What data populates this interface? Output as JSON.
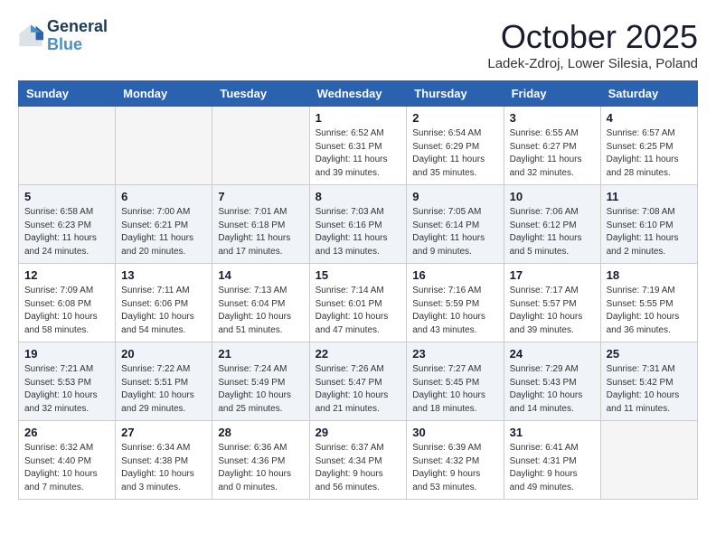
{
  "logo": {
    "line1": "General",
    "line2": "Blue"
  },
  "title": "October 2025",
  "subtitle": "Ladek-Zdroj, Lower Silesia, Poland",
  "weekdays": [
    "Sunday",
    "Monday",
    "Tuesday",
    "Wednesday",
    "Thursday",
    "Friday",
    "Saturday"
  ],
  "weeks": [
    [
      {
        "day": "",
        "info": ""
      },
      {
        "day": "",
        "info": ""
      },
      {
        "day": "",
        "info": ""
      },
      {
        "day": "1",
        "info": "Sunrise: 6:52 AM\nSunset: 6:31 PM\nDaylight: 11 hours\nand 39 minutes."
      },
      {
        "day": "2",
        "info": "Sunrise: 6:54 AM\nSunset: 6:29 PM\nDaylight: 11 hours\nand 35 minutes."
      },
      {
        "day": "3",
        "info": "Sunrise: 6:55 AM\nSunset: 6:27 PM\nDaylight: 11 hours\nand 32 minutes."
      },
      {
        "day": "4",
        "info": "Sunrise: 6:57 AM\nSunset: 6:25 PM\nDaylight: 11 hours\nand 28 minutes."
      }
    ],
    [
      {
        "day": "5",
        "info": "Sunrise: 6:58 AM\nSunset: 6:23 PM\nDaylight: 11 hours\nand 24 minutes."
      },
      {
        "day": "6",
        "info": "Sunrise: 7:00 AM\nSunset: 6:21 PM\nDaylight: 11 hours\nand 20 minutes."
      },
      {
        "day": "7",
        "info": "Sunrise: 7:01 AM\nSunset: 6:18 PM\nDaylight: 11 hours\nand 17 minutes."
      },
      {
        "day": "8",
        "info": "Sunrise: 7:03 AM\nSunset: 6:16 PM\nDaylight: 11 hours\nand 13 minutes."
      },
      {
        "day": "9",
        "info": "Sunrise: 7:05 AM\nSunset: 6:14 PM\nDaylight: 11 hours\nand 9 minutes."
      },
      {
        "day": "10",
        "info": "Sunrise: 7:06 AM\nSunset: 6:12 PM\nDaylight: 11 hours\nand 5 minutes."
      },
      {
        "day": "11",
        "info": "Sunrise: 7:08 AM\nSunset: 6:10 PM\nDaylight: 11 hours\nand 2 minutes."
      }
    ],
    [
      {
        "day": "12",
        "info": "Sunrise: 7:09 AM\nSunset: 6:08 PM\nDaylight: 10 hours\nand 58 minutes."
      },
      {
        "day": "13",
        "info": "Sunrise: 7:11 AM\nSunset: 6:06 PM\nDaylight: 10 hours\nand 54 minutes."
      },
      {
        "day": "14",
        "info": "Sunrise: 7:13 AM\nSunset: 6:04 PM\nDaylight: 10 hours\nand 51 minutes."
      },
      {
        "day": "15",
        "info": "Sunrise: 7:14 AM\nSunset: 6:01 PM\nDaylight: 10 hours\nand 47 minutes."
      },
      {
        "day": "16",
        "info": "Sunrise: 7:16 AM\nSunset: 5:59 PM\nDaylight: 10 hours\nand 43 minutes."
      },
      {
        "day": "17",
        "info": "Sunrise: 7:17 AM\nSunset: 5:57 PM\nDaylight: 10 hours\nand 39 minutes."
      },
      {
        "day": "18",
        "info": "Sunrise: 7:19 AM\nSunset: 5:55 PM\nDaylight: 10 hours\nand 36 minutes."
      }
    ],
    [
      {
        "day": "19",
        "info": "Sunrise: 7:21 AM\nSunset: 5:53 PM\nDaylight: 10 hours\nand 32 minutes."
      },
      {
        "day": "20",
        "info": "Sunrise: 7:22 AM\nSunset: 5:51 PM\nDaylight: 10 hours\nand 29 minutes."
      },
      {
        "day": "21",
        "info": "Sunrise: 7:24 AM\nSunset: 5:49 PM\nDaylight: 10 hours\nand 25 minutes."
      },
      {
        "day": "22",
        "info": "Sunrise: 7:26 AM\nSunset: 5:47 PM\nDaylight: 10 hours\nand 21 minutes."
      },
      {
        "day": "23",
        "info": "Sunrise: 7:27 AM\nSunset: 5:45 PM\nDaylight: 10 hours\nand 18 minutes."
      },
      {
        "day": "24",
        "info": "Sunrise: 7:29 AM\nSunset: 5:43 PM\nDaylight: 10 hours\nand 14 minutes."
      },
      {
        "day": "25",
        "info": "Sunrise: 7:31 AM\nSunset: 5:42 PM\nDaylight: 10 hours\nand 11 minutes."
      }
    ],
    [
      {
        "day": "26",
        "info": "Sunrise: 6:32 AM\nSunset: 4:40 PM\nDaylight: 10 hours\nand 7 minutes."
      },
      {
        "day": "27",
        "info": "Sunrise: 6:34 AM\nSunset: 4:38 PM\nDaylight: 10 hours\nand 3 minutes."
      },
      {
        "day": "28",
        "info": "Sunrise: 6:36 AM\nSunset: 4:36 PM\nDaylight: 10 hours\nand 0 minutes."
      },
      {
        "day": "29",
        "info": "Sunrise: 6:37 AM\nSunset: 4:34 PM\nDaylight: 9 hours\nand 56 minutes."
      },
      {
        "day": "30",
        "info": "Sunrise: 6:39 AM\nSunset: 4:32 PM\nDaylight: 9 hours\nand 53 minutes."
      },
      {
        "day": "31",
        "info": "Sunrise: 6:41 AM\nSunset: 4:31 PM\nDaylight: 9 hours\nand 49 minutes."
      },
      {
        "day": "",
        "info": ""
      }
    ]
  ]
}
